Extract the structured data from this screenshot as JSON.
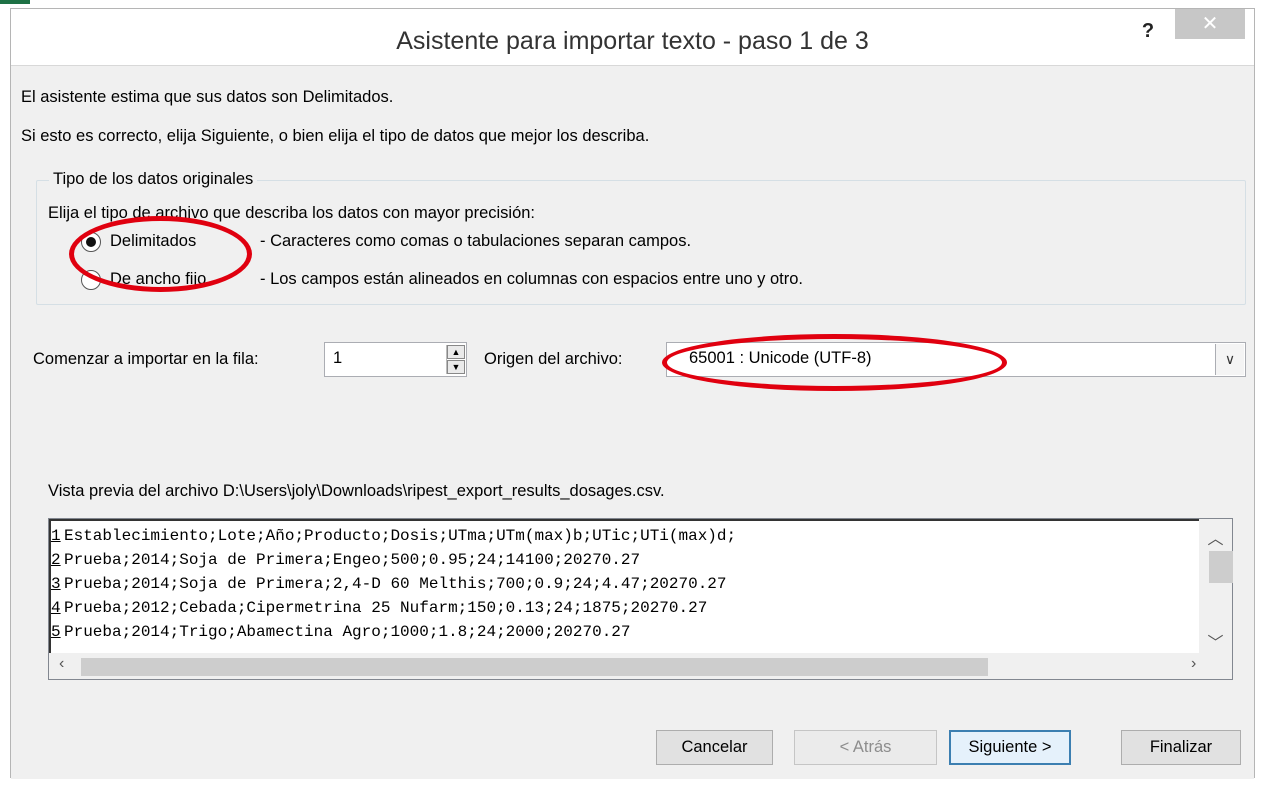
{
  "window": {
    "title": "Asistente para importar texto - paso 1 de 3",
    "help_label": "?",
    "close_label": "✕"
  },
  "intro": {
    "line1": "El asistente estima que sus datos son Delimitados.",
    "line2": "Si esto es correcto, elija Siguiente, o bien elija el tipo de datos que mejor los describa."
  },
  "data_type": {
    "group_title": "Tipo de los datos originales",
    "instruction": "Elija el tipo de archivo que describa los datos con mayor precisión:",
    "options": [
      {
        "label": "Delimitados",
        "description": "- Caracteres como comas o tabulaciones separan campos.",
        "selected": true
      },
      {
        "label": "De ancho fijo",
        "description": "- Los campos están alineados en columnas con espacios entre uno y otro.",
        "selected": false
      }
    ]
  },
  "start_row": {
    "label": "Comenzar a importar en la fila:",
    "value": "1"
  },
  "file_origin": {
    "label": "Origen del archivo:",
    "value": "65001 : Unicode (UTF-8)"
  },
  "preview": {
    "label": "Vista previa del archivo D:\\Users\\joly\\Downloads\\ripest_export_results_dosages.csv.",
    "lines": [
      {
        "num": "1",
        "text": "Establecimiento;Lote;Año;Producto;Dosis;UTma;UTm(max)b;UTic;UTi(max)d;"
      },
      {
        "num": "2",
        "text": "Prueba;2014;Soja de Primera;Engeo;500;0.95;24;14100;20270.27"
      },
      {
        "num": "3",
        "text": "Prueba;2014;Soja de Primera;2,4-D 60 Melthis;700;0.9;24;4.47;20270.27"
      },
      {
        "num": "4",
        "text": "Prueba;2012;Cebada;Cipermetrina 25 Nufarm;150;0.13;24;1875;20270.27"
      },
      {
        "num": "5",
        "text": "Prueba;2014;Trigo;Abamectina Agro;1000;1.8;24;2000;20270.27"
      }
    ]
  },
  "buttons": {
    "cancel": "Cancelar",
    "back": "< Atrás",
    "next": "Siguiente >",
    "finish": "Finalizar"
  },
  "annotation_color": "#e0000f",
  "accent_color": "#3c7fb1"
}
